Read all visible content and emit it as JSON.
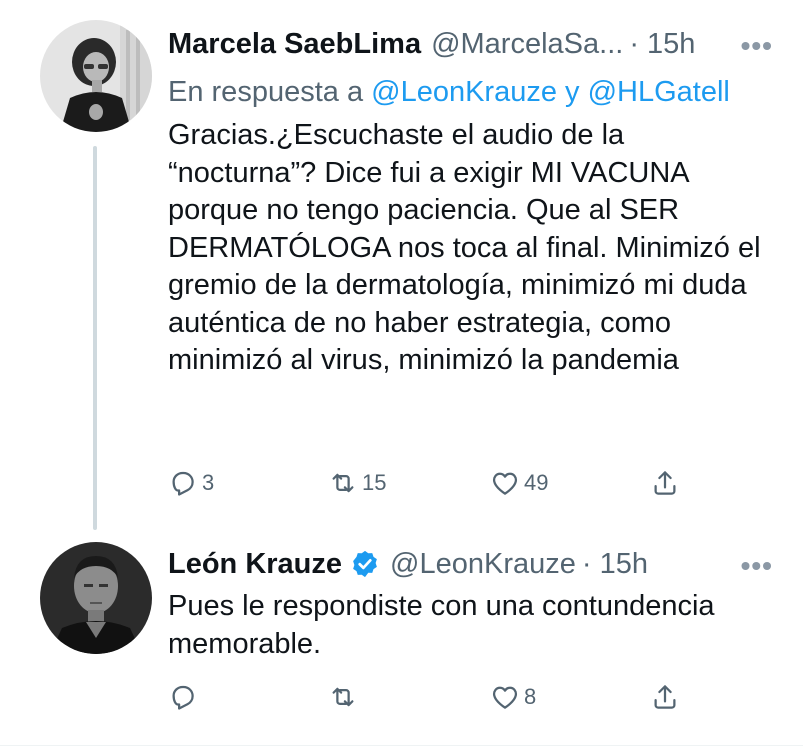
{
  "tweets": [
    {
      "name": "Marcela SaebLima",
      "handle": "@MarcelaSa...",
      "time": "· 15h",
      "more": "•••",
      "reply_prefix": "En respuesta a",
      "reply_mention_1": "@LeonKrauze",
      "reply_and": "y",
      "reply_mention_2": "@HLGatell",
      "text": "Gracias.¿Escuchaste el audio de la “nocturna”? Dice  fui a exigir MI VACUNA porque no tengo paciencia. Que al SER DERMATÓLOGA nos toca al final. Minimizó el gremio de la dermatología, minimizó mi duda auténtica de no haber estrategia, como minimizó al virus, minimizó la pandemia",
      "replies": "3",
      "retweets": "15",
      "likes": "49",
      "verified": false
    },
    {
      "name": "León Krauze",
      "handle": "@LeonKrauze",
      "time": "· 15h",
      "more": "•••",
      "text": "Pues le respondiste con una contundencia memorable.",
      "replies": "",
      "retweets": "",
      "likes": "8",
      "verified": true
    }
  ],
  "icons": {
    "reply": "reply-icon",
    "retweet": "retweet-icon",
    "like": "heart-icon",
    "share": "share-icon",
    "verified": "verified-badge-icon"
  },
  "colors": {
    "mention": "#1d9bf0",
    "secondary": "#536471",
    "verified": "#1d9bf0",
    "thread_line": "#cfd9de"
  }
}
